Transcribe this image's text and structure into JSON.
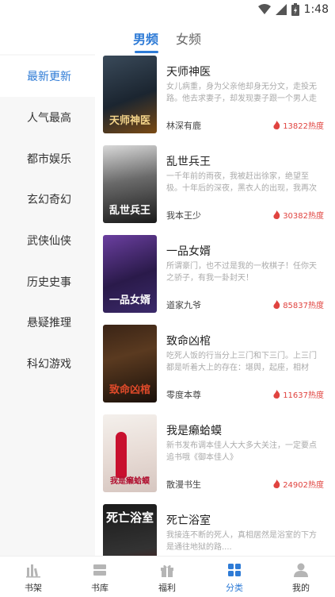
{
  "status_bar": {
    "time": "1:48"
  },
  "top_tabs": [
    {
      "label": "男频",
      "active": true
    },
    {
      "label": "女频",
      "active": false
    }
  ],
  "categories": [
    {
      "label": "最新更新",
      "active": true
    },
    {
      "label": "人气最高",
      "active": false
    },
    {
      "label": "都市娱乐",
      "active": false
    },
    {
      "label": "玄幻奇幻",
      "active": false
    },
    {
      "label": "武侠仙侠",
      "active": false
    },
    {
      "label": "历史史事",
      "active": false
    },
    {
      "label": "悬疑推理",
      "active": false
    },
    {
      "label": "科幻游戏",
      "active": false
    }
  ],
  "books": [
    {
      "title": "天师神医",
      "desc": "女儿病重，身为父亲他却身无分文，走投无路。他去求妻子，却发现妻子跟一个男人走出...",
      "author": "林深有鹿",
      "heat": "13822热度",
      "cover_text": "天师神医"
    },
    {
      "title": "乱世兵王",
      "desc": "一千年前的雨夜，我被赶出徐家，绝望至极。十年后的深夜，黑衣人的出现，我再次被推入万...",
      "author": "我本王少",
      "heat": "30382热度",
      "cover_text": "乱世兵王"
    },
    {
      "title": "一品女婿",
      "desc": "所谓豪门，也不过是我的一枚棋子！任你天之骄子，有我一卦封天！",
      "author": "道家九爷",
      "heat": "85837热度",
      "cover_text": "一品女婿"
    },
    {
      "title": "致命凶棺",
      "desc": "吃死人饭的行当分上三门和下三门。上三门都是听着大上的存在：堪舆，起座，相材铺。下...",
      "author": "零度本尊",
      "heat": "11637热度",
      "cover_text": "致命凶棺"
    },
    {
      "title": "我是癞蛤蟆",
      "desc": "新书发布调本佳人大大多大关注，一定要点追书哦《御本佳人》",
      "author": "散漫书生",
      "heat": "24902热度",
      "cover_text": "我是癞蛤蟆"
    },
    {
      "title": "死亡浴室",
      "desc": "我接连不断的死人，真相居然是浴室的下方是通往地狱的路....",
      "author": "",
      "heat": "",
      "cover_text": "死亡浴室"
    }
  ],
  "bottom_nav": [
    {
      "label": "书架",
      "icon": "bookshelf-icon",
      "active": false
    },
    {
      "label": "书库",
      "icon": "library-icon",
      "active": false
    },
    {
      "label": "福利",
      "icon": "gift-icon",
      "active": false
    },
    {
      "label": "分类",
      "icon": "category-icon",
      "active": true
    },
    {
      "label": "我的",
      "icon": "user-icon",
      "active": false
    }
  ],
  "colors": {
    "accent": "#2e7bd6",
    "heat": "#e0433f"
  }
}
